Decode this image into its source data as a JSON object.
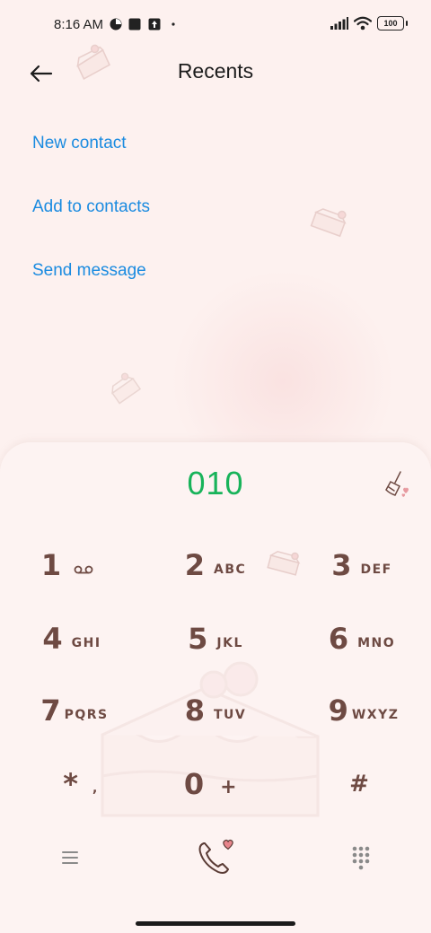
{
  "status_bar": {
    "time": "8:16 AM",
    "battery": "100"
  },
  "header": {
    "title": "Recents",
    "back_icon": "arrow-left-icon"
  },
  "actions": [
    {
      "label": "New contact"
    },
    {
      "label": "Add to contacts"
    },
    {
      "label": "Send message"
    }
  ],
  "dialer": {
    "number": "010",
    "keys": [
      {
        "digit": "1",
        "letters": "",
        "icon": "voicemail-icon"
      },
      {
        "digit": "2",
        "letters": "ABC"
      },
      {
        "digit": "3",
        "letters": "DEF"
      },
      {
        "digit": "4",
        "letters": "GHI"
      },
      {
        "digit": "5",
        "letters": "JKL"
      },
      {
        "digit": "6",
        "letters": "MNO"
      },
      {
        "digit": "7",
        "letters": "PQRS"
      },
      {
        "digit": "8",
        "letters": "TUV"
      },
      {
        "digit": "9",
        "letters": "WXYZ"
      },
      {
        "digit": "*",
        "letters": ","
      },
      {
        "digit": "0",
        "letters": "+"
      },
      {
        "digit": "#",
        "letters": ""
      }
    ]
  },
  "colors": {
    "accent_link": "#1a8be0",
    "number": "#18b35a",
    "key_text": "#6e4a43",
    "background": "#fdf1ef"
  }
}
